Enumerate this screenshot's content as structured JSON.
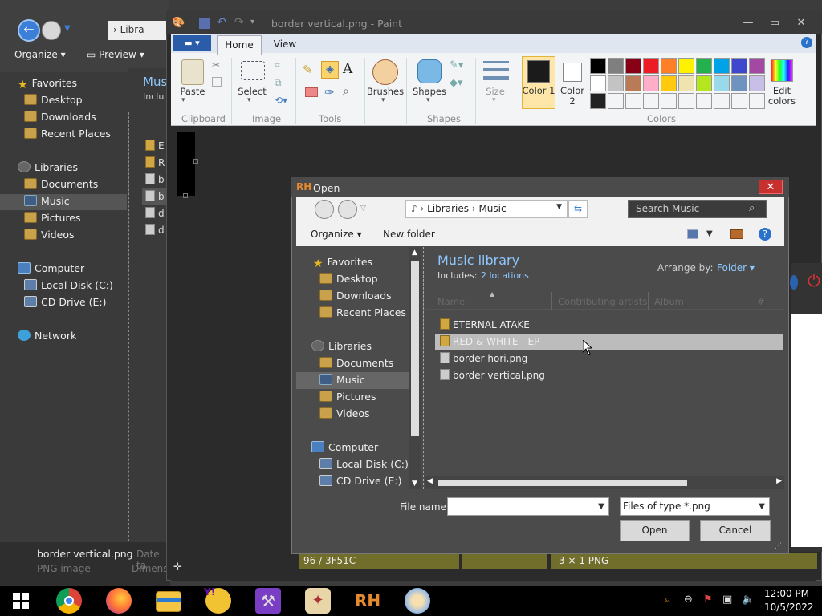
{
  "explorer": {
    "address": "Libra",
    "organize": "Organize",
    "preview": "Preview",
    "header_title": "Musi",
    "header_sub": "Inclu",
    "nav": {
      "favorites": "Favorites",
      "desktop": "Desktop",
      "downloads": "Downloads",
      "recent": "Recent Places",
      "libraries": "Libraries",
      "documents": "Documents",
      "music": "Music",
      "pictures": "Pictures",
      "videos": "Videos",
      "computer": "Computer",
      "local_disk": "Local Disk (C:)",
      "cd_drive": "CD Drive (E:)",
      "network": "Network"
    },
    "files": [
      "E",
      "R",
      "b",
      "b",
      "d",
      "d"
    ],
    "status_name": "border vertical.png",
    "status_type": "PNG image",
    "status_date_label": "Date ta",
    "status_dims_label": "Dimens"
  },
  "paint": {
    "title": "border vertical.png - Paint",
    "tabs": {
      "home": "Home",
      "view": "View"
    },
    "groups": {
      "clipboard": "Clipboard",
      "image": "Image",
      "tools": "Tools",
      "shapes": "Shapes",
      "colors": "Colors"
    },
    "buttons": {
      "paste": "Paste",
      "select": "Select",
      "brushes": "Brushes",
      "shapes": "Shapes",
      "size": "Size",
      "color1": "Color 1",
      "color2": "Color 2",
      "edit_colors": "Edit colors"
    },
    "palette_row1": [
      "#000000",
      "#7f7f7f",
      "#880015",
      "#ed1c24",
      "#ff7f27",
      "#fff200",
      "#22b14c",
      "#00a2e8",
      "#3f48cc",
      "#a349a4"
    ],
    "palette_row2": [
      "#ffffff",
      "#c3c3c3",
      "#b97a57",
      "#ffaec9",
      "#ffc90e",
      "#efe4b0",
      "#b5e61d",
      "#99d9ea",
      "#7092be",
      "#c8bfe7"
    ],
    "status": {
      "position": "96 / 3F51C",
      "size": "3 × 1  PNG"
    }
  },
  "dialog": {
    "icon": "RH",
    "title": "Open",
    "breadcrumb": [
      "Libraries",
      "Music"
    ],
    "search_placeholder": "Search Music",
    "organize": "Organize",
    "new_folder": "New folder",
    "nav": {
      "favorites": "Favorites",
      "desktop": "Desktop",
      "downloads": "Downloads",
      "recent": "Recent Places",
      "libraries": "Libraries",
      "documents": "Documents",
      "music": "Music",
      "pictures": "Pictures",
      "videos": "Videos",
      "computer": "Computer",
      "local_disk": "Local Disk (C:)",
      "cd_drive": "CD Drive (E:)"
    },
    "library_title": "Music library",
    "includes_label": "Includes:",
    "includes_link": "2 locations",
    "arrange_label": "Arrange by:",
    "arrange_value": "Folder",
    "columns": [
      "Name",
      "Contributing artists",
      "Album",
      "#"
    ],
    "files": [
      {
        "name": "ETERNAL ATAKE",
        "type": "folder"
      },
      {
        "name": "RED & WHITE - EP",
        "type": "folder"
      },
      {
        "name": "border hori.png",
        "type": "file"
      },
      {
        "name": "border vertical.png",
        "type": "file"
      }
    ],
    "filename_label": "File name:",
    "filename_value": "",
    "filetype": "Files of type *.png",
    "open": "Open",
    "cancel": "Cancel"
  },
  "taskbar": {
    "time": "12:00 PM",
    "date": "10/5/2022"
  }
}
